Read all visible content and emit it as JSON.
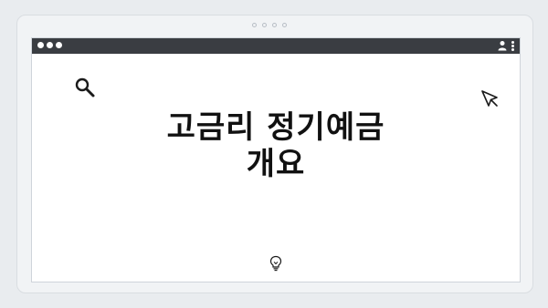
{
  "icons": {
    "search": "search-icon",
    "cursor": "cursor-icon",
    "lightbulb": "lightbulb-icon",
    "user": "user-icon",
    "menu": "kebab-menu-icon"
  },
  "colors": {
    "titlebar": "#3a3d42",
    "text": "#111111",
    "background": "#e9ecef"
  },
  "main": {
    "headline_line1": "고금리 정기예금",
    "headline_line2": "개요"
  }
}
